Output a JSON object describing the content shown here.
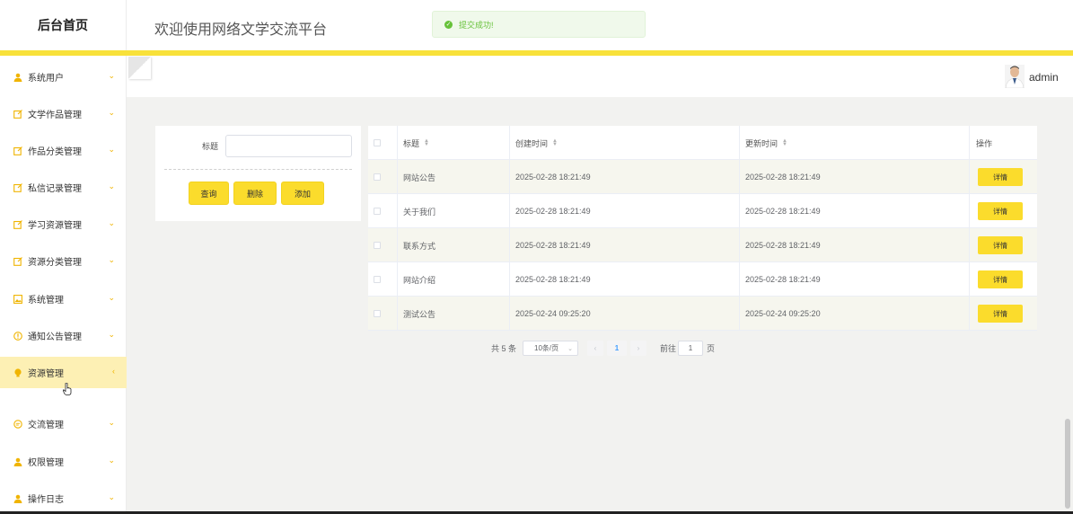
{
  "header": {
    "brand": "后台首页",
    "site_title": "欢迎使用网络文学交流平台"
  },
  "toast": {
    "message": "提交成功!",
    "icon": "check-circle-icon",
    "color": "#67c23a"
  },
  "user": {
    "name": "admin",
    "avatar_icon": "avatar-icon"
  },
  "colors": {
    "accent": "#fbdc2c",
    "active_menu_bg": "#fdf0b4",
    "pager_active": "#409eff"
  },
  "sidebar": {
    "items": [
      {
        "label": "系统用户",
        "icon": "user-icon",
        "caret": "⌄"
      },
      {
        "label": "文学作品管理",
        "icon": "edit-icon",
        "caret": "⌄"
      },
      {
        "label": "作品分类管理",
        "icon": "edit-icon",
        "caret": "⌄"
      },
      {
        "label": "私信记录管理",
        "icon": "edit-icon",
        "caret": "⌄"
      },
      {
        "label": "学习资源管理",
        "icon": "edit-icon",
        "caret": "⌄"
      },
      {
        "label": "资源分类管理",
        "icon": "edit-icon",
        "caret": "⌄"
      },
      {
        "label": "系统管理",
        "icon": "image-icon",
        "caret": "⌄"
      },
      {
        "label": "通知公告管理",
        "icon": "info-icon",
        "caret": "⌄"
      },
      {
        "label": "资源管理",
        "icon": "bulb-icon",
        "caret": "‹"
      },
      {
        "label": "交流管理",
        "icon": "chat-icon",
        "caret": "⌄"
      },
      {
        "label": "权限管理",
        "icon": "user-icon",
        "caret": "⌄"
      },
      {
        "label": "操作日志",
        "icon": "user-icon",
        "caret": "⌄"
      }
    ]
  },
  "search": {
    "label": "标题",
    "value": "",
    "buttons": {
      "query": "查询",
      "delete": "删除",
      "add": "添加"
    }
  },
  "table": {
    "columns": {
      "title": "标题",
      "created": "创建时间",
      "updated": "更新时间",
      "action": "操作"
    },
    "rows": [
      {
        "title": "网站公告",
        "created": "2025-02-28 18:21:49",
        "updated": "2025-02-28 18:21:49",
        "action": "详情"
      },
      {
        "title": "关于我们",
        "created": "2025-02-28 18:21:49",
        "updated": "2025-02-28 18:21:49",
        "action": "详情"
      },
      {
        "title": "联系方式",
        "created": "2025-02-28 18:21:49",
        "updated": "2025-02-28 18:21:49",
        "action": "详情"
      },
      {
        "title": "网站介绍",
        "created": "2025-02-28 18:21:49",
        "updated": "2025-02-28 18:21:49",
        "action": "详情"
      },
      {
        "title": "测试公告",
        "created": "2025-02-24 09:25:20",
        "updated": "2025-02-24 09:25:20",
        "action": "详情"
      }
    ]
  },
  "pagination": {
    "total": "共 5 条",
    "page_size": "10条/页",
    "current_page": "1",
    "goto_label": "前往",
    "goto_value": "1",
    "page_suffix": "页"
  }
}
